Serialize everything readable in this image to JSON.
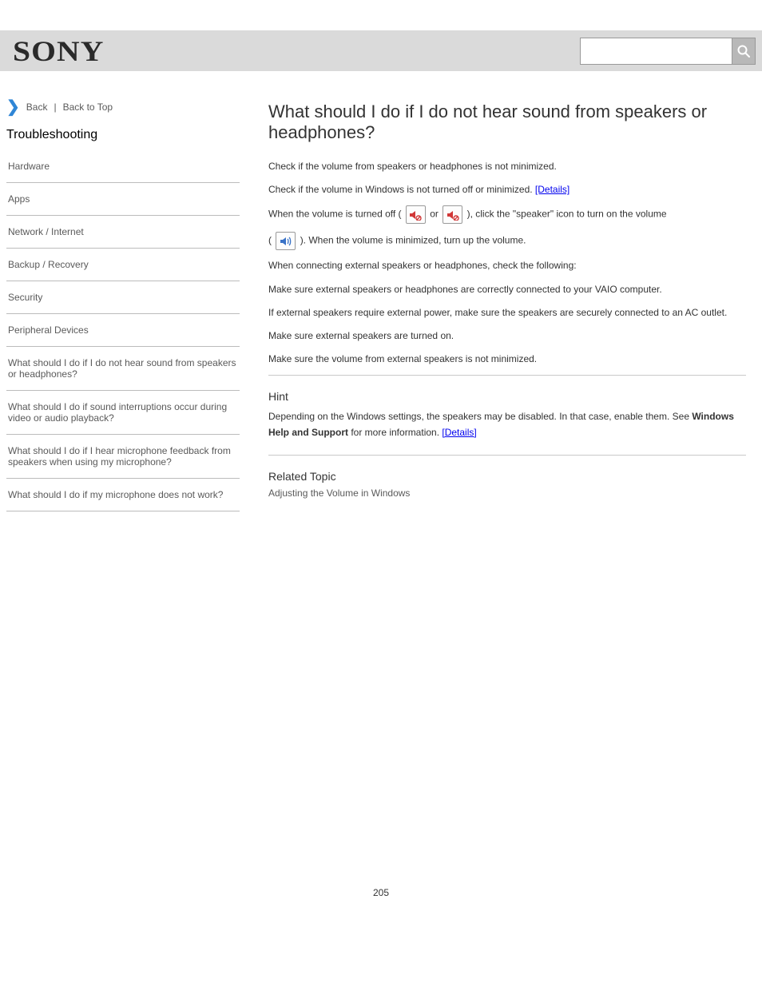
{
  "logo": "SONY",
  "search": {
    "placeholder": ""
  },
  "breadcrumb": {
    "back": "Back",
    "top": "Back to Top"
  },
  "nav": {
    "heading": "Troubleshooting",
    "items": [
      "Hardware",
      "Apps",
      "Network / Internet",
      "Backup / Recovery",
      "Security",
      "Peripheral Devices",
      "What should I do if I do not hear sound from speakers or headphones?",
      "What should I do if sound interruptions occur during video or audio playback?",
      "What should I do if I hear microphone feedback from speakers when using my microphone?",
      "What should I do if my microphone does not work?"
    ]
  },
  "article": {
    "title": "What should I do if I do not hear sound from speakers or headphones?",
    "paragraphs": [
      {
        "text": "Check if the volume from speakers or headphones is not minimized."
      },
      {
        "text": "Check if the volume in Windows is not turned off or minimized. <a href=\"#\">[Details]</a>"
      },
      {
        "pre": "When the volume is turned off ( ",
        "icon": "muted",
        "mid": " or ",
        "icon2": "muted",
        "post": " ), click the \"speaker\" icon to turn on the volume"
      },
      {
        "pre": "( ",
        "icon": "unmuted",
        "post": " ). When the volume is minimized, turn up the volume."
      },
      {
        "text": "When connecting external speakers or headphones, check the following:"
      },
      {
        "text": "Make sure external speakers or headphones are correctly connected to your VAIO computer."
      },
      {
        "text": "If external speakers require external power, make sure the speakers are securely connected to an AC outlet."
      },
      {
        "text": "Make sure external speakers are turned on."
      },
      {
        "text": "Make sure the volume from external speakers is not minimized."
      }
    ],
    "hint": "Hint",
    "hint_body": "Depending on the Windows settings, the speakers may be disabled. In that case, enable them. See <b>Windows Help and Support</b> for more information. <a href=\"#\">[Details]</a>",
    "related_heading": "Related Topic",
    "related_link": "Adjusting the Volume in Windows"
  },
  "page_number": "205"
}
